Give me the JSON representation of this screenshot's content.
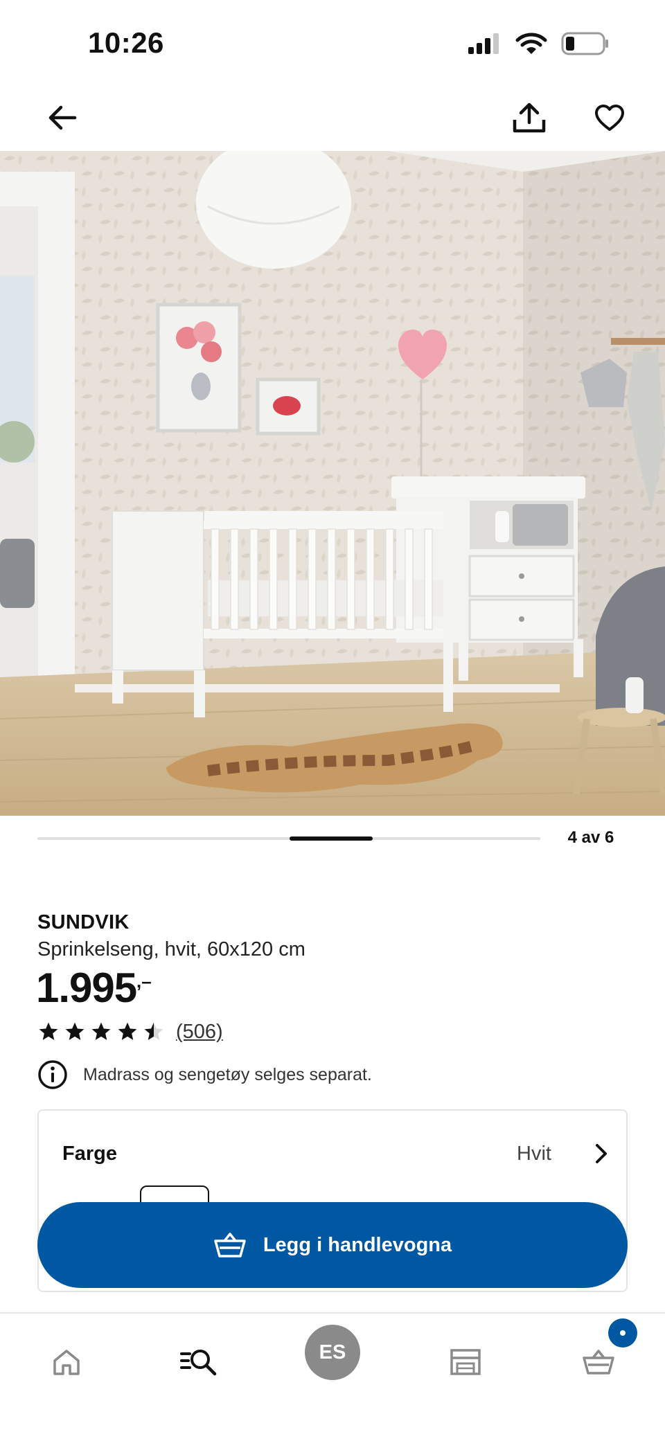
{
  "status_bar": {
    "time": "10:26",
    "icons": [
      "signal-icon",
      "wifi-icon",
      "battery-icon"
    ]
  },
  "header": {
    "back_icon": "arrow-left-icon",
    "share_icon": "share-icon",
    "favorite_icon": "heart-icon"
  },
  "gallery": {
    "image_alt": "SUNDVIK",
    "counter": "4 av 6",
    "current": 4,
    "total": 6
  },
  "product": {
    "name": "SUNDVIK",
    "description": "Sprinkelseng, hvit, 60x120 cm",
    "price": "1.995",
    "price_suffix": ",–",
    "rating": 4.5,
    "rating_max": 5,
    "review_count": "(506)",
    "info_text": "Madrass og sengetøy selges separat."
  },
  "color_option": {
    "label": "Farge",
    "value": "Hvit"
  },
  "cart_button": {
    "label": "Legg i handlevogna"
  },
  "bottom_nav": {
    "profile_initials": "ES",
    "items": [
      "home-icon",
      "search-icon",
      "profile-avatar",
      "store-icon",
      "cart-icon"
    ]
  },
  "colors": {
    "primary_blue": "#0058a3",
    "text": "#111111",
    "avatar_gray": "#8a8a8a"
  }
}
